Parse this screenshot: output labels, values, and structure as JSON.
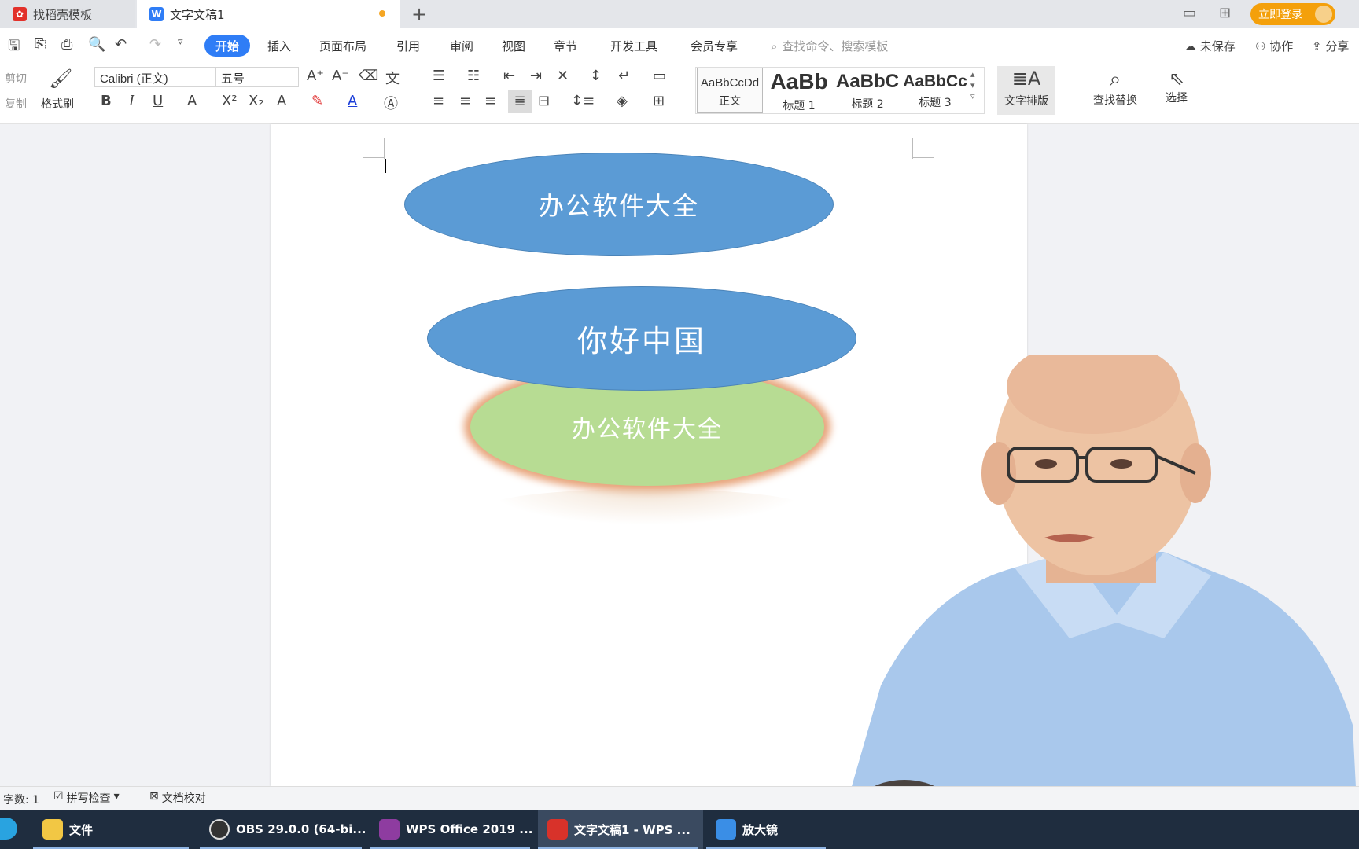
{
  "tabs": [
    {
      "label": "找稻壳模板",
      "icon": "docer-icon"
    },
    {
      "label": "文字文稿1",
      "icon": "wps-writer-icon"
    }
  ],
  "titlebar": {
    "login": "立即登录"
  },
  "menu": {
    "items": [
      "开始",
      "插入",
      "页面布局",
      "引用",
      "审阅",
      "视图",
      "章节",
      "开发工具",
      "会员专享"
    ],
    "search_placeholder": "查找命令、搜索模板",
    "right": [
      "未保存",
      "协作",
      "分享"
    ]
  },
  "ribbon": {
    "cut": "剪切",
    "copy": "复制",
    "format_painter": "格式刷",
    "font": "Calibri (正文)",
    "size": "五号",
    "styles": [
      {
        "preview": "AaBbCcDd",
        "label": "正文"
      },
      {
        "preview": "AaBb",
        "label": "标题 1"
      },
      {
        "preview": "AaBbC",
        "label": "标题 2"
      },
      {
        "preview": "AaBbCc",
        "label": "标题 3"
      }
    ],
    "text_layout": "文字排版",
    "find_replace": "查找替换",
    "select": "选择"
  },
  "document": {
    "shape1": "办公软件大全",
    "shape2": "你好中国",
    "shape3": "办公软件大全"
  },
  "status": {
    "word_count": "字数: 1",
    "spell_check": "拼写检查",
    "doc_proof": "文档校对"
  },
  "taskbar": [
    {
      "label": "文件",
      "color": "#f2c744"
    },
    {
      "label": "OBS 29.0.0 (64-bi...",
      "color": "#333333"
    },
    {
      "label": "WPS Office 2019 ...",
      "color": "#8e3ca0"
    },
    {
      "label": "文字文稿1 - WPS ...",
      "color": "#d8322a"
    },
    {
      "label": "放大镜",
      "color": "#3a8ee6"
    }
  ],
  "colors": {
    "accent": "#2f7df6",
    "shape_blue": "#5b9bd5",
    "shape_green": "#b7dc93",
    "shape_glow": "#e8a57c",
    "login": "#f4a00b"
  }
}
